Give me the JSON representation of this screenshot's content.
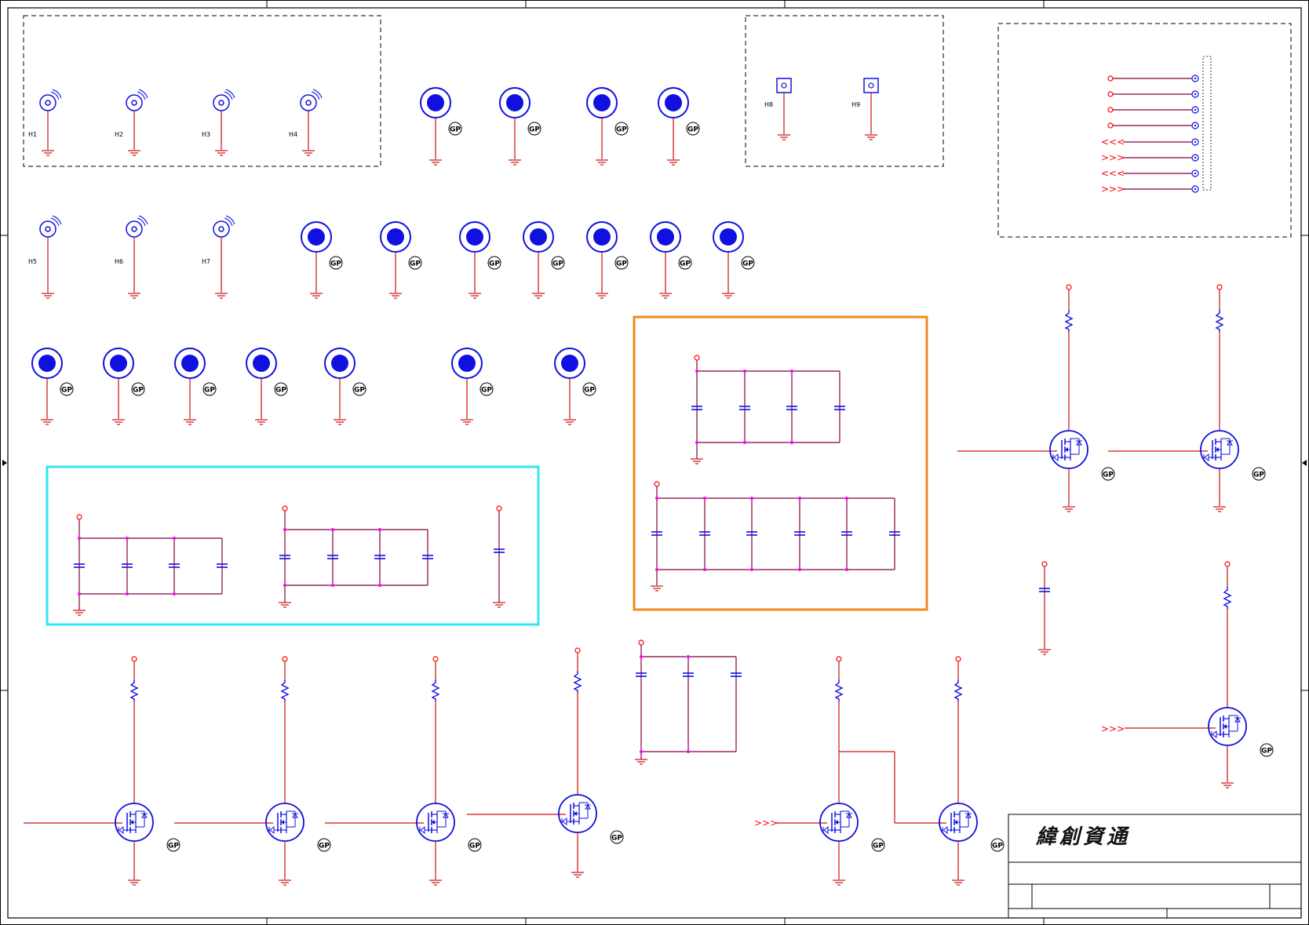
{
  "title_block": {
    "company": "緯創資通"
  },
  "designator_labels": {
    "gp": "GP"
  },
  "colors": {
    "wire": "#cc1111",
    "component": "#1010e0",
    "net": "#800040",
    "junction": "#ff00ff",
    "power_pin": "#ff0000",
    "frame": "#000000",
    "dashed_box": "#000000",
    "highlight_cyan": "#33e6f0",
    "highlight_orange": "#f28a1c"
  },
  "symbols": {
    "antenna": "antenna-icon",
    "test_point": "test-point-icon",
    "ground": "ground-icon",
    "mosfet": "mosfet-icon",
    "capacitor": "capacitor-icon",
    "resistor": "resistor-icon",
    "connector": "connector-icon"
  }
}
